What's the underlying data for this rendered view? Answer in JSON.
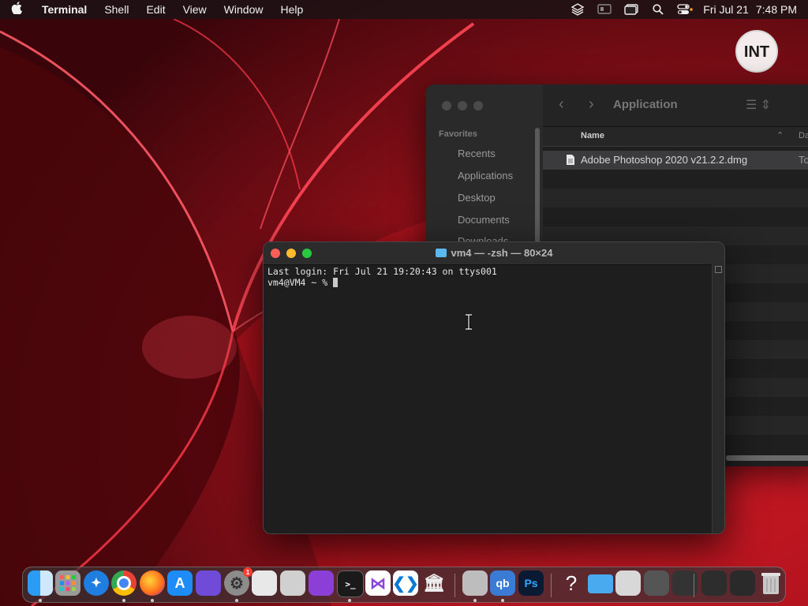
{
  "menubar": {
    "apple_icon": "apple-logo-icon",
    "app_name": "Terminal",
    "menus": [
      "Shell",
      "Edit",
      "View",
      "Window",
      "Help"
    ],
    "status_icons": [
      "layers-icon",
      "screen-mirror-icon",
      "window-icon",
      "search-icon",
      "control-center-icon"
    ],
    "date": "Fri Jul 21",
    "time": "7:48 PM"
  },
  "watermark": {
    "text": "INT"
  },
  "finder": {
    "title": "Application",
    "favorites_label": "Favorites",
    "favorites": [
      "Recents",
      "Applications",
      "Desktop",
      "Documents",
      "Downloads"
    ],
    "columns": {
      "name": "Name",
      "date": "Da"
    },
    "files": [
      {
        "name": "Adobe Photoshop 2020 v21.2.2.dmg",
        "kind": "To"
      }
    ]
  },
  "terminal": {
    "title": "vm4 — -zsh — 80×24",
    "lines": [
      "Last login: Fri Jul 21 19:20:43 on ttys001",
      "vm4@VM4 ~ % "
    ]
  },
  "dock": {
    "apps": [
      {
        "name": "finder-icon",
        "label": "",
        "color": "#1e8ef0",
        "running": true
      },
      {
        "name": "launchpad-icon",
        "label": "",
        "color": "#9a9a9a",
        "running": false
      },
      {
        "name": "safari-icon",
        "label": "",
        "color": "#1f7fe0",
        "running": false
      },
      {
        "name": "chrome-icon",
        "label": "",
        "color": "#d9d9d9",
        "running": true
      },
      {
        "name": "firefox-icon",
        "label": "",
        "color": "#ff7a1a",
        "running": true
      },
      {
        "name": "app-store-icon",
        "label": "",
        "color": "#1d8cf6",
        "running": false
      },
      {
        "name": "shortcuts-icon",
        "label": "",
        "color": "#6f4bd8",
        "running": false
      },
      {
        "name": "system-settings-icon",
        "label": "",
        "color": "#8c8c8c",
        "running": true,
        "badge": "1"
      },
      {
        "name": "textedit-icon",
        "label": "",
        "color": "#e8e8e8",
        "running": false
      },
      {
        "name": "screenshot-icon",
        "label": "",
        "color": "#d0d0d0",
        "running": false
      },
      {
        "name": "pocket-icon",
        "label": "",
        "color": "#8b3fd6",
        "running": false
      },
      {
        "name": "terminal-icon",
        "label": ">_",
        "color": "#1a1a1a",
        "running": true
      },
      {
        "name": "visual-studio-icon",
        "label": "",
        "color": "#ffffff",
        "running": false
      },
      {
        "name": "vscode-icon",
        "label": "",
        "color": "#ffffff",
        "running": false
      },
      {
        "name": "library-icon",
        "label": "",
        "color": "#3a3a3a",
        "running": false
      },
      {
        "name": "disk-utility-icon",
        "label": "",
        "color": "#bdbdbd",
        "running": true
      },
      {
        "name": "qbittorrent-icon",
        "label": "qb",
        "color": "#3a7bd5",
        "running": true
      },
      {
        "name": "photoshop-icon",
        "label": "Ps",
        "color": "#0b1a33",
        "running": false
      },
      {
        "name": "help-icon",
        "label": "?",
        "color": "#3a3a3a",
        "running": false
      },
      {
        "name": "folder-icon",
        "label": "",
        "color": "#4aaaf0",
        "running": false
      },
      {
        "name": "stack-documents-icon",
        "label": "",
        "color": "#d8d8d8",
        "running": false
      },
      {
        "name": "stack-screenshots-icon",
        "label": "",
        "color": "#555555",
        "running": false
      },
      {
        "name": "stack-downloads-icon",
        "label": "",
        "color": "#333333",
        "running": false
      },
      {
        "name": "stack-desktop-icon",
        "label": "",
        "color": "#2d2d2d",
        "running": false
      },
      {
        "name": "stack-recent-icon",
        "label": "",
        "color": "#2a2a2a",
        "running": false
      },
      {
        "name": "trash-icon",
        "label": "",
        "color": "#bfbfbf",
        "running": false
      }
    ]
  },
  "colors": {
    "wallpaper_base": "#5a0a10",
    "wallpaper_glow": "#ff2a3c",
    "close": "#ff5f57",
    "minimize": "#febc2e",
    "zoom": "#28c840"
  }
}
